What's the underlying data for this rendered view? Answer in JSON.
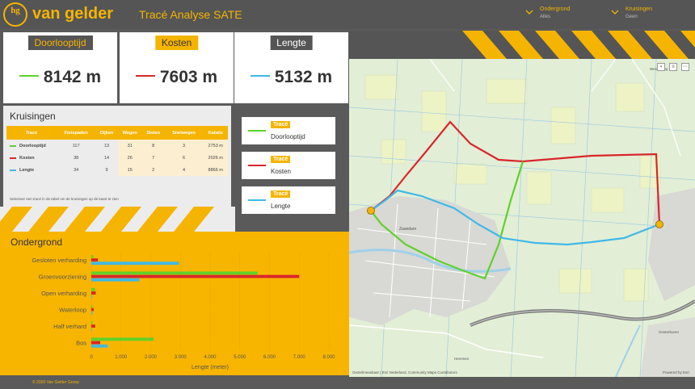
{
  "brand": {
    "logo_mark": "hg",
    "logo_text": "van gelder",
    "app_title": "Tracé Analyse SATE"
  },
  "filters": [
    {
      "title": "Ondergrond",
      "value": "Alles"
    },
    {
      "title": "Kruisingen",
      "value": "Geen"
    }
  ],
  "kpis": [
    {
      "label": "Doorlooptijd",
      "value": "8142 m",
      "color": "#5fd12a"
    },
    {
      "label": "Kosten",
      "value": "7603 m",
      "color": "#d9262b"
    },
    {
      "label": "Lengte",
      "value": "5132 m",
      "color": "#3fb9e8"
    }
  ],
  "kruisingen": {
    "title": "Kruisingen",
    "columns": [
      "Tracé",
      "Fietspaden",
      "Dijken",
      "Wegen",
      "Sloten",
      "Snelwegen",
      "Kabels"
    ],
    "rows": [
      {
        "name": "Doorlooptijd",
        "color": "#5fd12a",
        "values": [
          "117",
          "13",
          "31",
          "8",
          "3",
          "2753 m"
        ]
      },
      {
        "name": "Kosten",
        "color": "#d9262b",
        "values": [
          "38",
          "14",
          "26",
          "7",
          "6",
          "2026 m"
        ]
      },
      {
        "name": "Lengte",
        "color": "#3fb9e8",
        "values": [
          "34",
          "9",
          "15",
          "2",
          "4",
          "8866 m"
        ]
      }
    ],
    "footnote": "Selecteer een tracé in de tabel om de kruisingen op de kaart te zien"
  },
  "legend": [
    {
      "tag": "Tracé",
      "label": "Doorlooptijd",
      "color": "#5fd12a"
    },
    {
      "tag": "Tracé",
      "label": "Kosten",
      "color": "#d9262b"
    },
    {
      "tag": "Tracé",
      "label": "Lengte",
      "color": "#3fb9e8"
    }
  ],
  "map": {
    "labels": [
      "Zaandam",
      "Westerweg",
      "Hemmes",
      "Oosterburen"
    ],
    "attribution": "Gestelmeasbaar | Esri Nederland, Community Maps Contributors",
    "powered": "Powered by Esri"
  },
  "ondergrond": {
    "title": "Ondergrond",
    "chart_data": {
      "type": "bar",
      "orientation": "horizontal",
      "categories": [
        "Gesloten verharding",
        "Groenvoorziening",
        "Open verharding",
        "Waterloop",
        "Half verhard",
        "Bos"
      ],
      "series": [
        {
          "color": "#5fd12a",
          "values": [
            60,
            5600,
            120,
            30,
            40,
            2100
          ]
        },
        {
          "color": "#d9262b",
          "values": [
            220,
            7000,
            150,
            80,
            130,
            300
          ]
        },
        {
          "color": "#3fb9e8",
          "values": [
            2950,
            1620,
            30,
            40,
            20,
            550
          ]
        }
      ],
      "xlim": [
        0,
        8000
      ],
      "xticks": [
        "0",
        "1.000",
        "2.000",
        "3.000",
        "4.000",
        "5.000",
        "6.000",
        "7.000",
        "8.000"
      ],
      "xlabel": "Lengte (meter)",
      "colors": {
        "text": "#555555",
        "grid": "#e09a00"
      }
    }
  },
  "footer": "© 2020 Van Gelder Groep"
}
